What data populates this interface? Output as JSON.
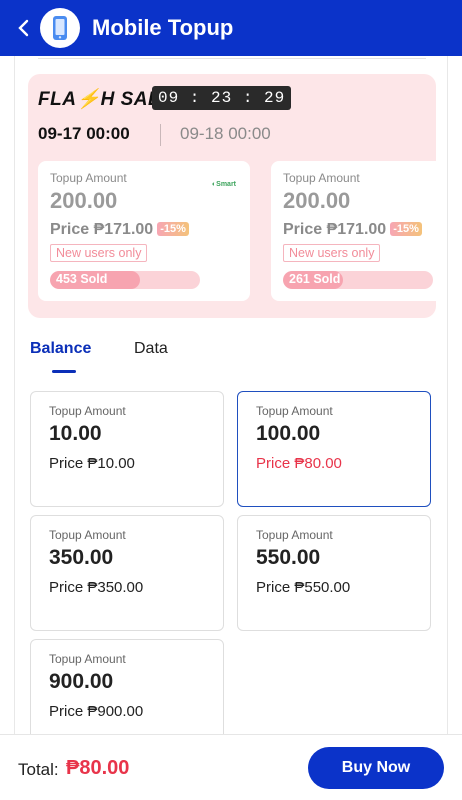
{
  "header": {
    "title": "Mobile Topup",
    "back_icon": "chevron-left-icon",
    "app_icon": "phone-icon"
  },
  "flash_sale": {
    "logo": "FLASH SALE",
    "countdown": "09 : 23 : 29",
    "sessions": {
      "active": "09-17 00:00",
      "next": "09-18 00:00"
    },
    "cards": [
      {
        "label": "Topup Amount",
        "amount": "200.00",
        "price": "Price ₱171.00",
        "discount": "-15%",
        "tag": "New users only",
        "sold": "453 Sold",
        "sold_progress": 0.6,
        "brand": "Smart"
      },
      {
        "label": "Topup Amount",
        "amount": "200.00",
        "price": "Price ₱171.00",
        "discount": "-15%",
        "tag": "New users only",
        "sold": "261 Sold",
        "sold_progress": 0.4
      }
    ]
  },
  "tabs": {
    "balance": "Balance",
    "data": "Data",
    "active": "Balance"
  },
  "products": [
    {
      "label": "Topup Amount",
      "amount": "10.00",
      "price": "Price ₱10.00",
      "selected": false
    },
    {
      "label": "Topup Amount",
      "amount": "100.00",
      "price": "Price ₱80.00",
      "selected": true
    },
    {
      "label": "Topup Amount",
      "amount": "350.00",
      "price": "Price ₱350.00",
      "selected": false
    },
    {
      "label": "Topup Amount",
      "amount": "550.00",
      "price": "Price ₱550.00",
      "selected": false
    },
    {
      "label": "Topup Amount",
      "amount": "900.00",
      "price": "Price ₱900.00",
      "selected": false
    }
  ],
  "footer": {
    "total_label": "Total:",
    "total_value": "₱80.00",
    "buy_label": "Buy Now"
  },
  "colors": {
    "brand": "#0b33c9",
    "accent_red": "#e8344a",
    "flash_bg": "#fde6e8"
  }
}
